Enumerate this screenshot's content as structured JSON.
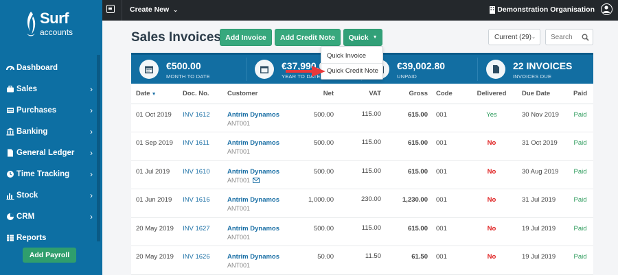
{
  "brand": {
    "line1": "Surf",
    "line2": "accounts"
  },
  "topbar": {
    "create_new": "Create New",
    "organisation": "Demonstration Organisation"
  },
  "sidebar": {
    "items": [
      {
        "label": "Dashboard",
        "icon": "dashboard-icon",
        "chevron": false
      },
      {
        "label": "Sales",
        "icon": "briefcase-icon",
        "chevron": true
      },
      {
        "label": "Purchases",
        "icon": "list-icon",
        "chevron": true
      },
      {
        "label": "Banking",
        "icon": "bank-icon",
        "chevron": true
      },
      {
        "label": "General Ledger",
        "icon": "document-icon",
        "chevron": true
      },
      {
        "label": "Time Tracking",
        "icon": "clock-icon",
        "chevron": true
      },
      {
        "label": "Stock",
        "icon": "bar-chart-icon",
        "chevron": true
      },
      {
        "label": "CRM",
        "icon": "pie-chart-icon",
        "chevron": true
      },
      {
        "label": "Reports",
        "icon": "table-icon",
        "chevron": false
      }
    ],
    "add_payroll": "Add Payroll"
  },
  "header": {
    "title": "Sales Invoices",
    "add_invoice": "Add Invoice",
    "add_credit_note": "Add Credit Note",
    "quick": "Quick",
    "filter": "Current (29)",
    "search_placeholder": "Search"
  },
  "quick_menu": {
    "item1": "Quick Invoice",
    "item2": "Quick Credit Note"
  },
  "summary": [
    {
      "value": "€500.00",
      "label": "MONTH TO DATE",
      "icon": "calendar-icon"
    },
    {
      "value": "€37,990.0",
      "label": "YEAR TO DATE",
      "icon": "calendar-icon"
    },
    {
      "value": "€39,002.80",
      "label": "UNPAID",
      "icon": "calendar-icon"
    },
    {
      "value": "22 INVOICES",
      "label": "INVOICES DUE",
      "icon": "document-icon"
    }
  ],
  "table": {
    "headers": [
      "Date",
      "Doc. No.",
      "Customer",
      "Net",
      "VAT",
      "Gross",
      "Code",
      "Delivered",
      "Due Date",
      "Paid"
    ],
    "rows": [
      {
        "date": "01 Oct 2019",
        "doc": "INV 1612",
        "customer": "Antrim Dynamos",
        "code_cust": "ANT001",
        "net": "500.00",
        "vat": "115.00",
        "gross": "615.00",
        "code": "001",
        "delivered": "Yes",
        "due": "30 Nov 2019",
        "paid": "Paid"
      },
      {
        "date": "01 Sep 2019",
        "doc": "INV 1611",
        "customer": "Antrim Dynamos",
        "code_cust": "ANT001",
        "net": "500.00",
        "vat": "115.00",
        "gross": "615.00",
        "code": "001",
        "delivered": "No",
        "due": "31 Oct 2019",
        "paid": "Paid"
      },
      {
        "date": "01 Jul 2019",
        "doc": "INV 1610",
        "customer": "Antrim Dynamos",
        "code_cust": "ANT001",
        "net": "500.00",
        "vat": "115.00",
        "gross": "615.00",
        "code": "001",
        "delivered": "No",
        "due": "30 Aug 2019",
        "paid": "Paid",
        "email": true
      },
      {
        "date": "01 Jun 2019",
        "doc": "INV 1616",
        "customer": "Antrim Dynamos",
        "code_cust": "ANT001",
        "net": "1,000.00",
        "vat": "230.00",
        "gross": "1,230.00",
        "code": "001",
        "delivered": "No",
        "due": "31 Jul 2019",
        "paid": "Paid"
      },
      {
        "date": "20 May 2019",
        "doc": "INV 1627",
        "customer": "Antrim Dynamos",
        "code_cust": "ANT001",
        "net": "500.00",
        "vat": "115.00",
        "gross": "615.00",
        "code": "001",
        "delivered": "No",
        "due": "19 Jul 2019",
        "paid": "Paid"
      },
      {
        "date": "20 May 2019",
        "doc": "INV 1626",
        "customer": "Antrim Dynamos",
        "code_cust": "ANT001",
        "net": "50.00",
        "vat": "11.50",
        "gross": "61.50",
        "code": "001",
        "delivered": "No",
        "due": "19 Jul 2019",
        "paid": "Paid"
      }
    ]
  },
  "colors": {
    "sidebar": "#0d6fa3",
    "topbar": "#24282c",
    "accent_green": "#37a87d",
    "summary": "#126ea2",
    "delivered_no": "#e02020",
    "delivered_yes": "#2a9a5a"
  }
}
